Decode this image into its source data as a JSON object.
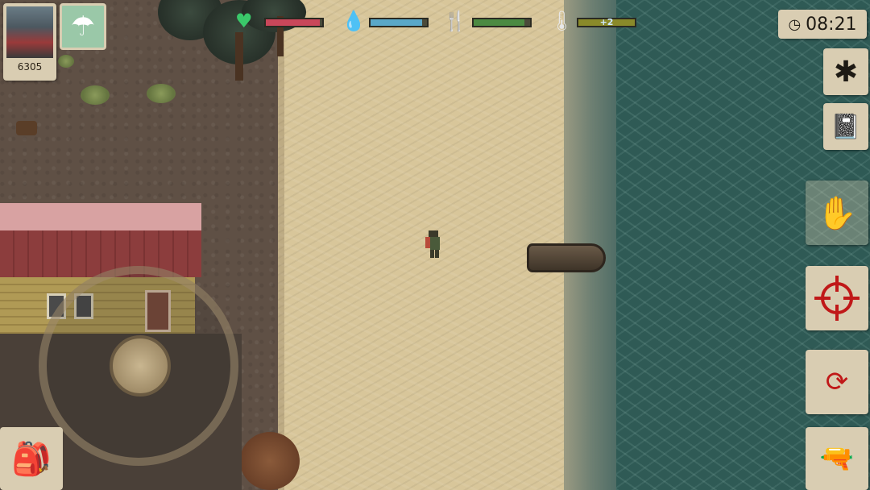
{
  "hud": {
    "player": {
      "score": "6305",
      "portrait_icon": "soldier-portrait-icon"
    },
    "airdrop_icon": "parachute-icon",
    "stats": {
      "health": {
        "icon": "heart-icon",
        "level": 0.95,
        "color": "#c9475a"
      },
      "water": {
        "icon": "water-drop-icon",
        "level": 0.92,
        "color": "#5aa8c8"
      },
      "food": {
        "icon": "fork-knife-icon",
        "level": 0.9,
        "color": "#4c8a42"
      },
      "temperature": {
        "icon": "thermometer-icon",
        "level": 1.0,
        "color": "#8a8a2a",
        "label": "+2"
      }
    },
    "clock": {
      "time": "08:21",
      "icon": "clock-icon"
    }
  },
  "side_buttons": {
    "settings": {
      "icon": "gear-icon"
    },
    "quests": {
      "icon": "notebook-icon"
    },
    "interact": {
      "icon": "hand-grab-icon"
    },
    "aim": {
      "icon": "crosshair-icon"
    },
    "reload": {
      "icon": "magazine-reload-icon"
    },
    "weapon": {
      "icon": "pistol-icon"
    }
  },
  "controls": {
    "joystick_icon": "joystick",
    "backpack_icon": "backpack-icon"
  },
  "scene": {
    "terrain": [
      "dirt",
      "sand",
      "water"
    ],
    "objects": [
      "house",
      "boat",
      "player",
      "trees",
      "bushes"
    ]
  }
}
